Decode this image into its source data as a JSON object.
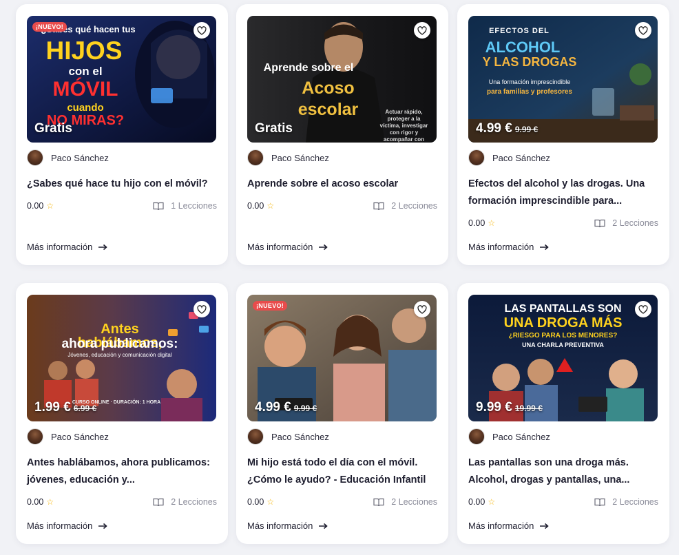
{
  "courses": [
    {
      "badge": "¡NUEVO!",
      "price": "Gratis",
      "old_price": "",
      "thumb_lines": [
        "¿Sabes qué hacen tus",
        "HIJOS",
        "con el",
        "MÓVIL",
        "cuando",
        "NO MIRAS?"
      ],
      "author": "Paco Sánchez",
      "title": "¿Sabes qué hace tu hijo con el móvil?",
      "rating": "0.00",
      "lessons": "1 Lecciones",
      "more": "Más información"
    },
    {
      "badge": "",
      "price": "Gratis",
      "old_price": "",
      "thumb_lines": [
        "Aprende sobre el",
        "Acoso",
        "escolar",
        "Actuar rápido,",
        "proteger a la",
        "víctima, investigar",
        "con rigor y",
        "acompañar con"
      ],
      "author": "Paco Sánchez",
      "title": "Aprende sobre el acoso escolar",
      "rating": "0.00",
      "lessons": "2 Lecciones",
      "more": "Más información"
    },
    {
      "badge": "",
      "price": "4.99 €",
      "old_price": "9.99 €",
      "thumb_lines": [
        "EFECTOS DEL",
        "ALCOHOL",
        "Y LAS DROGAS",
        "Una formación imprescindible",
        "para familias y profesores"
      ],
      "author": "Paco Sánchez",
      "title": "Efectos del alcohol y las drogas. Una formación imprescindible para...",
      "rating": "0.00",
      "lessons": "2 Lecciones",
      "more": "Más información"
    },
    {
      "badge": "",
      "price": "1.99 €",
      "old_price": "6.99 €",
      "thumb_lines": [
        "Antes hablábamos,",
        "ahora publicamos:",
        "Jóvenes, educación y comunicación digital",
        "CURSO ONLINE · DURACIÓN: 1 HORA"
      ],
      "author": "Paco Sánchez",
      "title": "Antes hablábamos, ahora publicamos: jóvenes, educación y...",
      "rating": "0.00",
      "lessons": "2 Lecciones",
      "more": "Más información"
    },
    {
      "badge": "¡NUEVO!",
      "price": "4.99 €",
      "old_price": "9.99 €",
      "thumb_lines": [],
      "author": "Paco Sánchez",
      "title": "Mi hijo está todo el día con el móvil. ¿Cómo le ayudo? - Educación Infantil",
      "rating": "0.00",
      "lessons": "2 Lecciones",
      "more": "Más información"
    },
    {
      "badge": "",
      "price": "9.99 €",
      "old_price": "19.99 €",
      "thumb_lines": [
        "LAS PANTALLAS SON",
        "UNA DROGA MÁS",
        "¿RIESGO PARA LOS MENORES?",
        "UNA CHARLA PREVENTIVA"
      ],
      "author": "Paco Sánchez",
      "title": "Las pantallas son una droga más. Alcohol, drogas y pantallas, una...",
      "rating": "0.00",
      "lessons": "2 Lecciones",
      "more": "Más información"
    }
  ],
  "colors": {
    "accent_red": "#e84c4c",
    "star": "#f5b301",
    "muted": "#8a8b99"
  },
  "icons": [
    "heart-icon",
    "star-icon",
    "book-icon",
    "arrow-right-icon"
  ]
}
